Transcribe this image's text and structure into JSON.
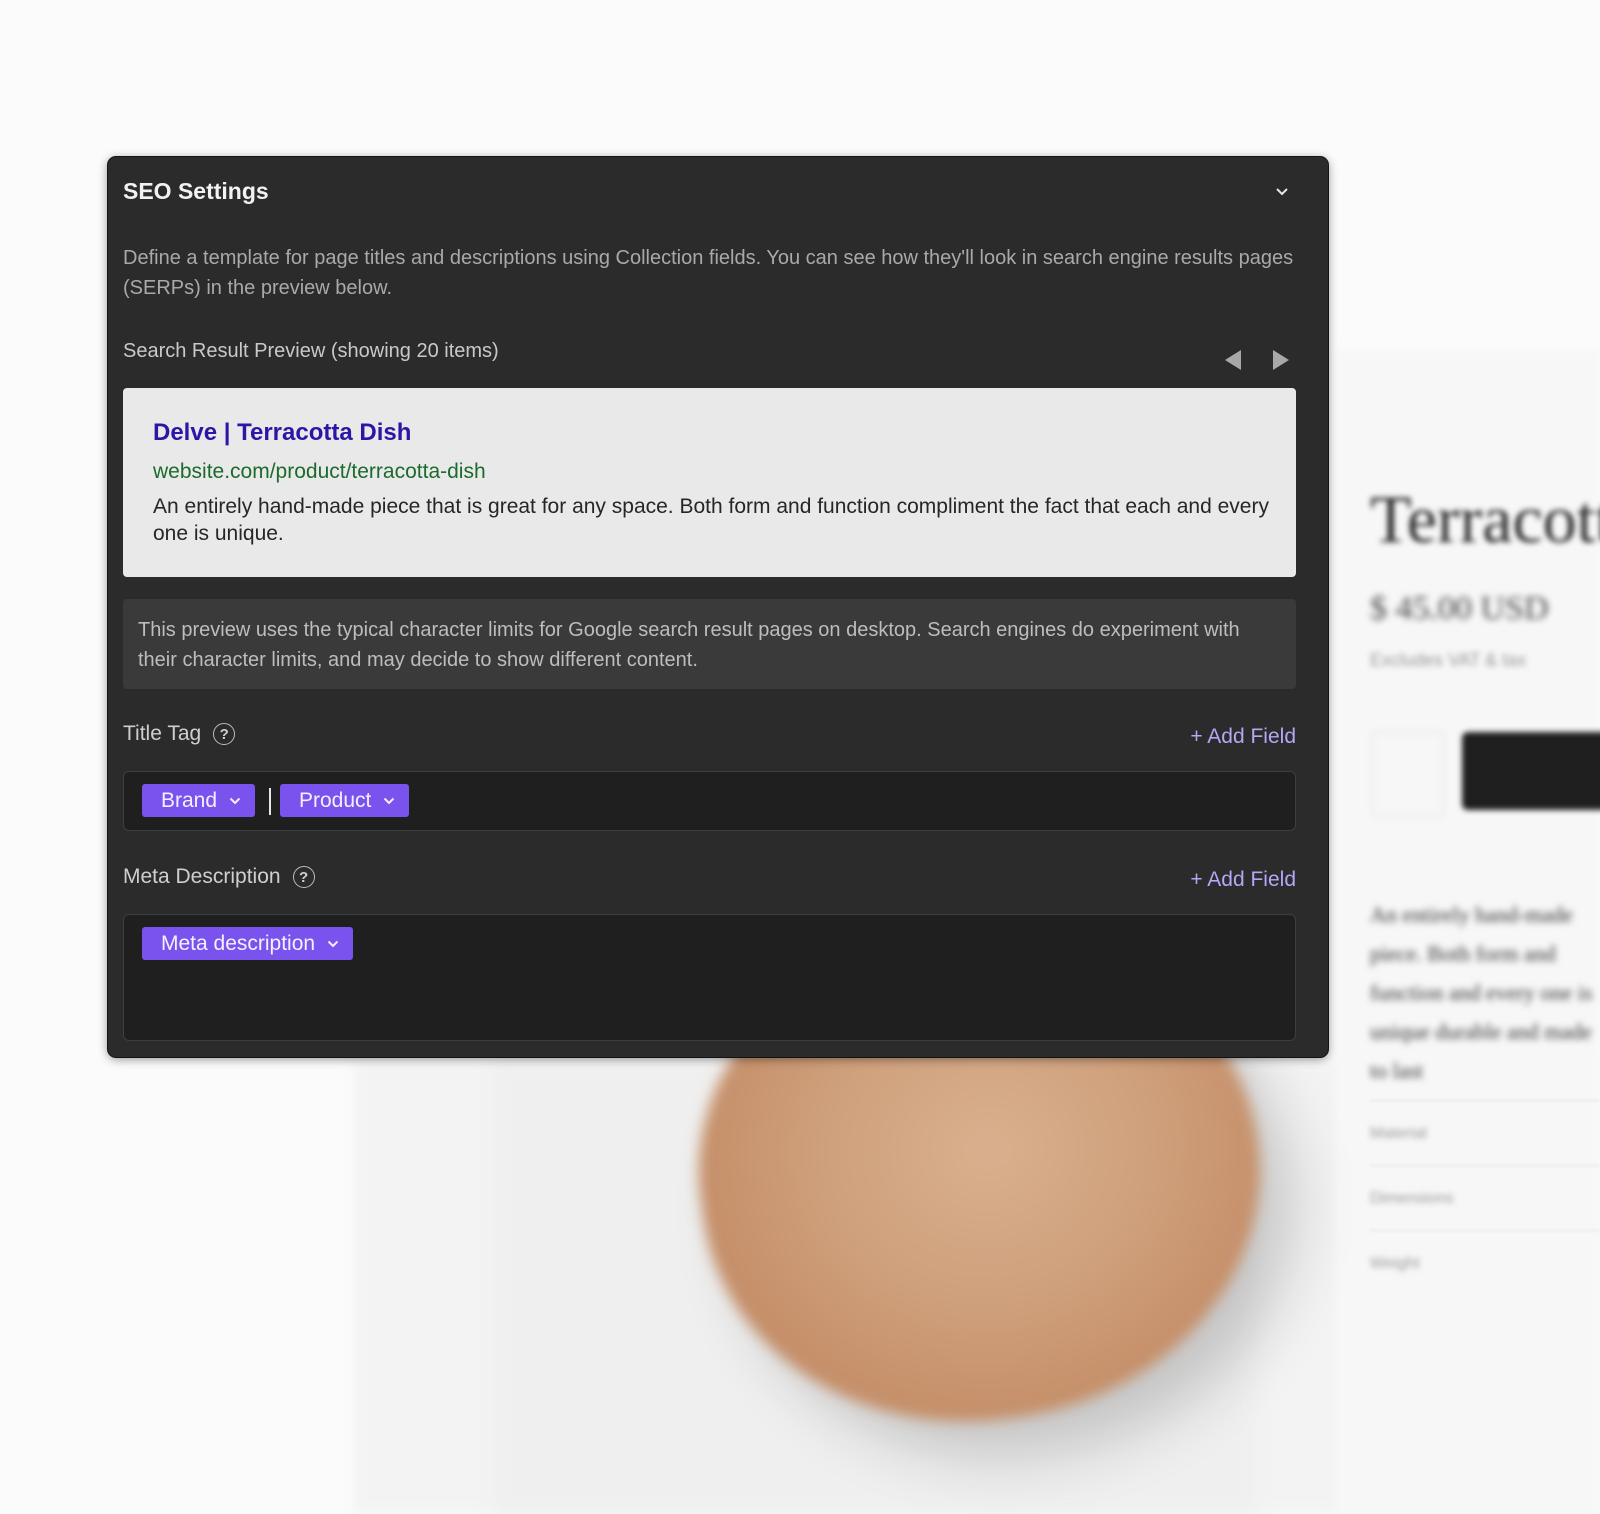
{
  "panel": {
    "title": "SEO Settings",
    "intro": "Define a template for page titles and descriptions using Collection fields. You can see how they'll look in search engine results pages (SERPs) in the preview below.",
    "preview_label": "Search Result Preview (showing 20 items)"
  },
  "serp": {
    "title": "Delve | Terracotta Dish",
    "url": "website.com/product/terracotta-dish",
    "description": "An entirely hand-made piece that is great for any space. Both form and function compliment the fact that each and every one is unique."
  },
  "note": "This preview uses the typical character limits for Google search result pages on desktop. Search engines do experiment with their character limits, and may decide to show different content.",
  "title_tag": {
    "label": "Title Tag",
    "add_field": "+ Add Field",
    "fields": [
      "Brand",
      "Product"
    ]
  },
  "meta_description": {
    "label": "Meta Description",
    "add_field": "+ Add Field",
    "fields": [
      "Meta description"
    ]
  },
  "background_page": {
    "title": "Terracott",
    "price": "$ 45.00 USD",
    "price_note": "Excludes VAT & tax",
    "description": "An entirely hand-made piece. Both form and function and every one is unique durable and made to last",
    "meta_items": [
      "Material",
      "Dimensions",
      "Weight"
    ]
  },
  "colors": {
    "panel_bg": "#2b2b2b",
    "serp_title": "#2a17a6",
    "serp_url": "#1c6b2c",
    "pill": "#7a52ee",
    "add_field": "#b7a5f5"
  },
  "icons": [
    "chevron-down-icon",
    "arrow-left-icon",
    "arrow-right-icon",
    "help-icon",
    "chevron-down-icon"
  ]
}
